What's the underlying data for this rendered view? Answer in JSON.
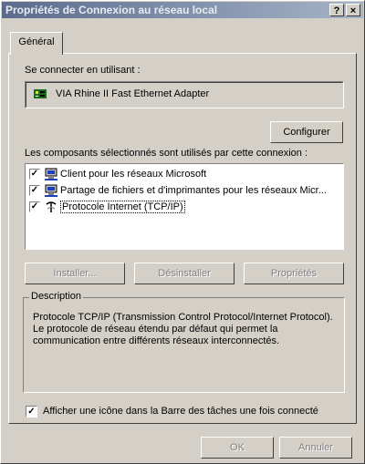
{
  "window": {
    "title": "Propriétés de Connexion au réseau local",
    "help_btn": "?",
    "close_btn": "×"
  },
  "tabs": [
    {
      "label": "Général",
      "active": true
    }
  ],
  "connect": {
    "label": "Se connecter en utilisant :",
    "adapter": "VIA Rhine II Fast Ethernet Adapter",
    "configure_btn": "Configurer"
  },
  "components": {
    "label": "Les composants sélectionnés sont utilisés par cette connexion :",
    "items": [
      {
        "label": "Client pour les réseaux Microsoft",
        "checked": true,
        "icon": "network-client-icon"
      },
      {
        "label": "Partage de fichiers et d'imprimantes pour les réseaux Micr...",
        "checked": true,
        "icon": "file-printer-sharing-icon"
      },
      {
        "label": "Protocole Internet (TCP/IP)",
        "checked": true,
        "icon": "protocol-icon",
        "selected": true
      }
    ]
  },
  "actions": {
    "install": "Installer...",
    "uninstall": "Désinstaller",
    "properties": "Propriétés"
  },
  "description": {
    "title": "Description",
    "text": "Protocole TCP/IP (Transmission Control Protocol/Internet Protocol). Le protocole de réseau étendu par défaut qui permet la communication entre différents réseaux interconnectés."
  },
  "tray_option": {
    "label": "Afficher une icône dans la Barre des tâches une fois connecté",
    "checked": true
  },
  "footer": {
    "ok": "OK",
    "cancel": "Annuler"
  },
  "colors": {
    "face": "#d4d0c8",
    "title_start": "#5b6b8c",
    "title_end": "#a6b4c8"
  }
}
